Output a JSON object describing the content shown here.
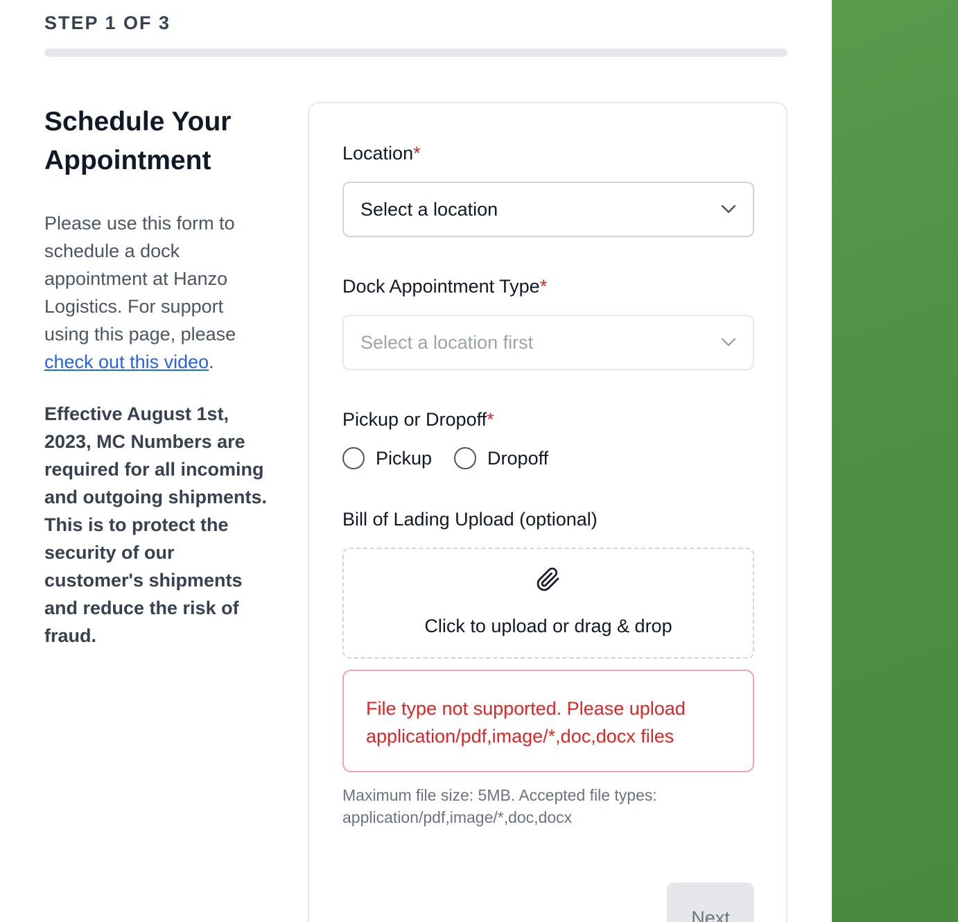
{
  "step": {
    "label": "STEP 1 OF 3",
    "progress_fraction": 0.0
  },
  "intro": {
    "title": "Schedule Your Appointment",
    "text_before_link": "Please use this form to schedule a dock appointment at Hanzo Logistics. For support using this page, please ",
    "link_text": "check out this video",
    "text_after_link": ".",
    "notice": "Effective August 1st, 2023, MC Numbers are required for all incoming and outgoing shipments. This is to protect the security of our customer's shipments and reduce the risk of fraud."
  },
  "form": {
    "required_mark": "*",
    "location": {
      "label": "Location",
      "value": "Select a location",
      "icon": "chevron-down-icon"
    },
    "dock_type": {
      "label": "Dock Appointment Type",
      "value": "Select a location first",
      "icon": "chevron-down-icon"
    },
    "pickup_dropoff": {
      "label": "Pickup or Dropoff",
      "options": [
        "Pickup",
        "Dropoff"
      ]
    },
    "upload": {
      "label": "Bill of Lading Upload (optional)",
      "icon": "paperclip-icon",
      "prompt": "Click to upload or drag & drop"
    },
    "error": "File type not supported. Please upload application/pdf,image/*,doc,docx files",
    "help": "Maximum file size: 5MB. Accepted file types: application/pdf,image/*,doc,docx",
    "next_label": "Next"
  },
  "colors": {
    "accent_green": "#5a9a4d",
    "error_red": "#dc2626",
    "link_blue": "#2563eb"
  }
}
